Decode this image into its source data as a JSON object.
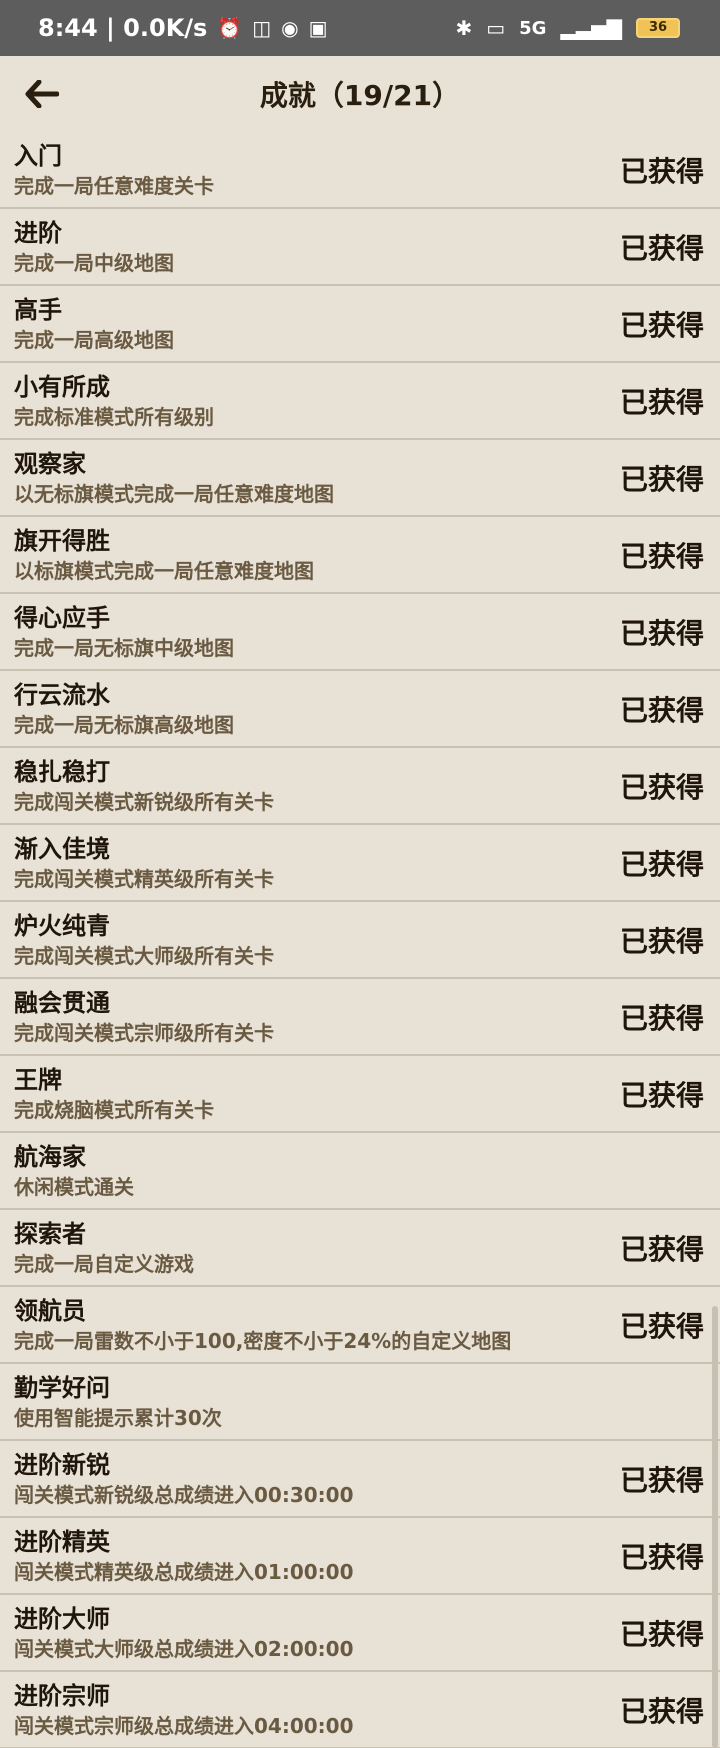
{
  "status_bar": {
    "time_speed": "8:44 | 0.0K/s",
    "signal": "5G",
    "battery": "36"
  },
  "header": {
    "title": "成就（19/21）"
  },
  "achievements": [
    {
      "name": "入门",
      "desc": "完成一局任意难度关卡",
      "status": "已获得"
    },
    {
      "name": "进阶",
      "desc": "完成一局中级地图",
      "status": "已获得"
    },
    {
      "name": "高手",
      "desc": "完成一局高级地图",
      "status": "已获得"
    },
    {
      "name": "小有所成",
      "desc": "完成标准模式所有级别",
      "status": "已获得"
    },
    {
      "name": "观察家",
      "desc": "以无标旗模式完成一局任意难度地图",
      "status": "已获得"
    },
    {
      "name": "旗开得胜",
      "desc": "以标旗模式完成一局任意难度地图",
      "status": "已获得"
    },
    {
      "name": "得心应手",
      "desc": "完成一局无标旗中级地图",
      "status": "已获得"
    },
    {
      "name": "行云流水",
      "desc": "完成一局无标旗高级地图",
      "status": "已获得"
    },
    {
      "name": "稳扎稳打",
      "desc": "完成闯关模式新锐级所有关卡",
      "status": "已获得"
    },
    {
      "name": "渐入佳境",
      "desc": "完成闯关模式精英级所有关卡",
      "status": "已获得"
    },
    {
      "name": "炉火纯青",
      "desc": "完成闯关模式大师级所有关卡",
      "status": "已获得"
    },
    {
      "name": "融会贯通",
      "desc": "完成闯关模式宗师级所有关卡",
      "status": "已获得"
    },
    {
      "name": "王牌",
      "desc": "完成烧脑模式所有关卡",
      "status": "已获得"
    },
    {
      "name": "航海家",
      "desc": "休闲模式通关",
      "status": ""
    },
    {
      "name": "探索者",
      "desc": "完成一局自定义游戏",
      "status": "已获得"
    },
    {
      "name": "领航员",
      "desc": "完成一局雷数不小于100,密度不小于24%的自定义地图",
      "status": "已获得"
    },
    {
      "name": "勤学好问",
      "desc": "使用智能提示累计30次",
      "status": ""
    },
    {
      "name": "进阶新锐",
      "desc": "闯关模式新锐级总成绩进入00:30:00",
      "status": "已获得"
    },
    {
      "name": "进阶精英",
      "desc": "闯关模式精英级总成绩进入01:00:00",
      "status": "已获得"
    },
    {
      "name": "进阶大师",
      "desc": "闯关模式大师级总成绩进入02:00:00",
      "status": "已获得"
    },
    {
      "name": "进阶宗师",
      "desc": "闯关模式宗师级总成绩进入04:00:00",
      "status": "已获得"
    }
  ]
}
